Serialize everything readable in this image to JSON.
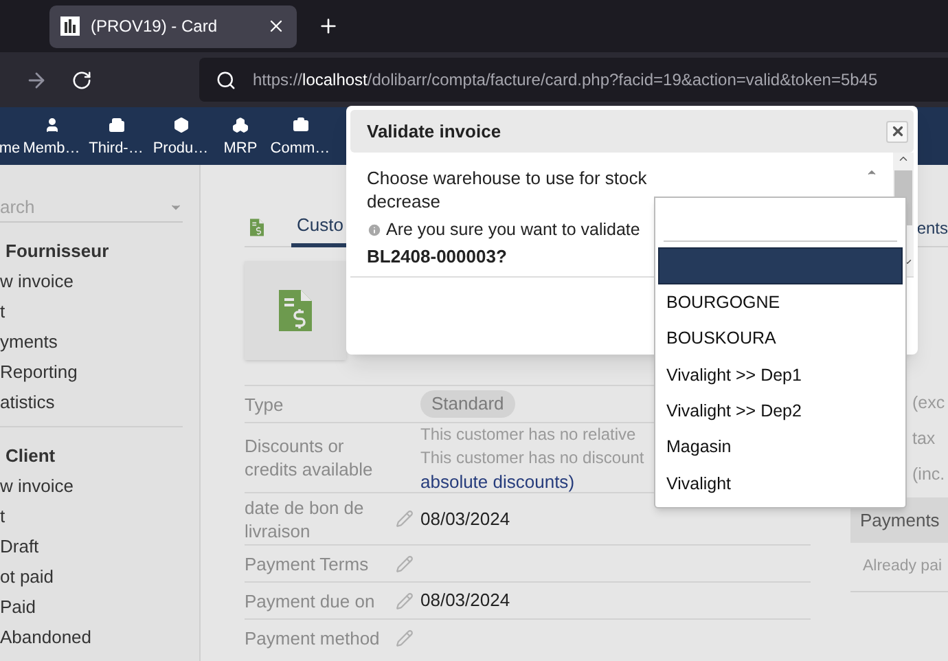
{
  "browser": {
    "tab_title": "(PROV19) - Card",
    "url_prefix": "https://",
    "url_host": "localhost",
    "url_path": "/dolibarr/compta/facture/card.php?facid=19&action=valid&token=5b45"
  },
  "nav_items": [
    {
      "label": "me"
    },
    {
      "label": "Memb…"
    },
    {
      "label": "Third-…"
    },
    {
      "label": "Produ…"
    },
    {
      "label": "MRP"
    },
    {
      "label": "Comm…"
    }
  ],
  "sidebar": {
    "search_placeholder": "arch",
    "sections": [
      {
        "title": "Fournisseur",
        "items": [
          "w invoice",
          "t",
          "yments",
          "Reporting",
          "atistics"
        ]
      },
      {
        "title": "Client",
        "items": [
          "w invoice",
          "t",
          "Draft",
          "ot paid",
          "Paid",
          "Abandoned"
        ]
      }
    ]
  },
  "content": {
    "tabs": [
      {
        "label": "Custo",
        "selected": true
      },
      {
        "label": "ents",
        "selected": false
      }
    ],
    "fields": [
      {
        "label": "Type",
        "kind": "badge",
        "editable": false,
        "value": "Standard"
      },
      {
        "label": "Discounts or credits available",
        "kind": "discounts",
        "editable": false,
        "lines": [
          "This customer has no relative",
          "This customer has no discount"
        ],
        "link": "absolute discounts",
        "after_link": ")"
      },
      {
        "label": "date de bon de livraison",
        "kind": "text",
        "editable": true,
        "value": "08/03/2024"
      },
      {
        "label": "Payment Terms",
        "kind": "text",
        "editable": true
      },
      {
        "label": "Payment due on",
        "kind": "text",
        "editable": true,
        "value": "08/03/2024"
      },
      {
        "label": "Payment method",
        "kind": "text",
        "editable": true
      }
    ],
    "summary_labels": [
      "(exc",
      "tax",
      "(inc."
    ],
    "payments": {
      "title": "Payments",
      "rows": [
        "Already pai"
      ]
    }
  },
  "dialog": {
    "title": "Validate invoice",
    "warehouse_label": "Choose warehouse to use for stock decrease",
    "question": "Are you sure you want to validate",
    "reference": "BL2408-000003?",
    "dropdown": {
      "blank_option": {
        "selected": true
      },
      "options": [
        {
          "label": "BOURGOGNE",
          "selected": false
        },
        {
          "label": "BOUSKOURA",
          "selected": false
        },
        {
          "label": "Vivalight >> Dep1",
          "selected": false
        },
        {
          "label": "Vivalight >> Dep2",
          "selected": false
        },
        {
          "label": "Magasin",
          "selected": false
        },
        {
          "label": "Vivalight",
          "selected": false
        }
      ]
    }
  }
}
